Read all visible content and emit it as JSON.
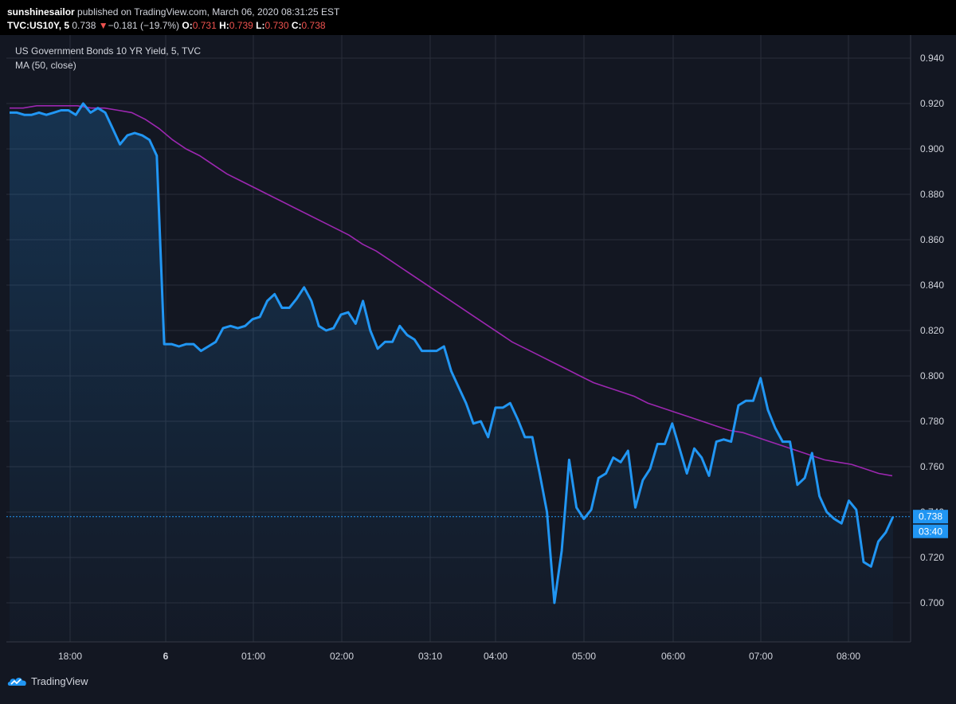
{
  "header": {
    "author": "sunshinesailor",
    "published_text": "published on TradingView.com, March 06, 2020 08:31:25 EST",
    "symbol": "TVC:US10Y, 5",
    "last": "0.738",
    "change_arrow": "▼",
    "change": "−0.181 (−19.7%)",
    "open_label": "O:",
    "open": "0.731",
    "high_label": "H:",
    "high": "0.739",
    "low_label": "L:",
    "low": "0.730",
    "close_label": "C:",
    "close": "0.738"
  },
  "legend": {
    "series_title": "US Government Bonds 10 YR Yield, 5, TVC",
    "ma_title": "MA (50, close)"
  },
  "footer": {
    "logo_text": "TradingView"
  },
  "colors": {
    "background": "#131722",
    "grid": "#2a2e39",
    "price_line": "#2196f3",
    "ma_line": "#9c27b0",
    "down": "#ef5350"
  },
  "chart_data": {
    "type": "area",
    "title": "US Government Bonds 10 YR Yield, 5, TVC",
    "x_ticks": [
      "18:00",
      "6",
      "01:00",
      "02:00",
      "03:10",
      "04:00",
      "05:00",
      "06:00",
      "07:00",
      "08:00"
    ],
    "y_ticks": [
      "0.700",
      "0.720",
      "0.740",
      "0.760",
      "0.780",
      "0.800",
      "0.820",
      "0.840",
      "0.860",
      "0.880",
      "0.900",
      "0.920",
      "0.940"
    ],
    "ylim": [
      0.68,
      0.946
    ],
    "last_value_label": "0.738",
    "countdown_label": "03:40",
    "series": [
      {
        "name": "US10Y",
        "values": [
          0.916,
          0.916,
          0.915,
          0.915,
          0.916,
          0.915,
          0.916,
          0.917,
          0.917,
          0.915,
          0.92,
          0.916,
          0.918,
          0.916,
          0.909,
          0.902,
          0.906,
          0.907,
          0.906,
          0.904,
          0.897,
          0.814,
          0.814,
          0.813,
          0.814,
          0.814,
          0.811,
          0.813,
          0.815,
          0.821,
          0.822,
          0.821,
          0.822,
          0.825,
          0.826,
          0.833,
          0.836,
          0.83,
          0.83,
          0.834,
          0.839,
          0.833,
          0.822,
          0.82,
          0.821,
          0.827,
          0.828,
          0.823,
          0.833,
          0.82,
          0.812,
          0.815,
          0.815,
          0.822,
          0.818,
          0.816,
          0.811,
          0.811,
          0.811,
          0.813,
          0.802,
          0.795,
          0.788,
          0.779,
          0.78,
          0.773,
          0.786,
          0.786,
          0.788,
          0.781,
          0.773,
          0.773,
          0.757,
          0.74,
          0.7,
          0.723,
          0.763,
          0.742,
          0.737,
          0.741,
          0.755,
          0.757,
          0.764,
          0.762,
          0.767,
          0.742,
          0.754,
          0.759,
          0.77,
          0.77,
          0.779,
          0.768,
          0.757,
          0.768,
          0.764,
          0.756,
          0.771,
          0.772,
          0.771,
          0.787,
          0.789,
          0.789,
          0.799,
          0.785,
          0.777,
          0.771,
          0.771,
          0.752,
          0.755,
          0.766,
          0.747,
          0.74,
          0.737,
          0.735,
          0.745,
          0.741,
          0.718,
          0.716,
          0.727,
          0.731,
          0.738
        ]
      },
      {
        "name": "MA (50, close)",
        "values": [
          0.918,
          0.918,
          0.919,
          0.919,
          0.919,
          0.919,
          0.918,
          0.918,
          0.917,
          0.916,
          0.913,
          0.909,
          0.904,
          0.9,
          0.897,
          0.893,
          0.889,
          0.886,
          0.883,
          0.88,
          0.877,
          0.874,
          0.871,
          0.868,
          0.865,
          0.862,
          0.858,
          0.855,
          0.851,
          0.847,
          0.843,
          0.839,
          0.835,
          0.831,
          0.827,
          0.823,
          0.819,
          0.815,
          0.812,
          0.809,
          0.806,
          0.803,
          0.8,
          0.797,
          0.795,
          0.793,
          0.791,
          0.788,
          0.786,
          0.784,
          0.782,
          0.78,
          0.778,
          0.776,
          0.775,
          0.773,
          0.771,
          0.769,
          0.767,
          0.765,
          0.763,
          0.762,
          0.761,
          0.759,
          0.757,
          0.756
        ]
      }
    ]
  }
}
